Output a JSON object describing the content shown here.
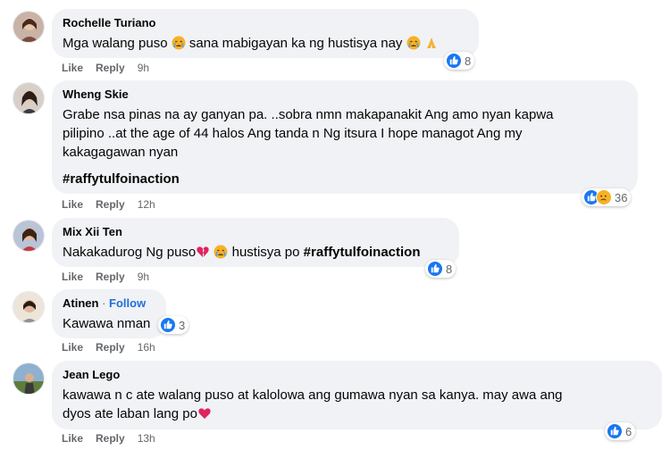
{
  "comments": [
    {
      "author": "Rochelle Turiano",
      "text_a": "Mga walang puso",
      "text_b": "sana mabigayan ka ng hustisya nay",
      "like_label": "Like",
      "reply_label": "Reply",
      "time": "9h",
      "reaction_count": "8"
    },
    {
      "author": "Wheng Skie",
      "lines": [
        "Grabe nsa pinas na ay ganyan pa. ..sobra nmn makapanakit Ang amo nyan kapwa",
        "pilipino ..at the age of 44 halos Ang tanda n Ng itsura I hope managot Ang my",
        "kakagagawan nyan"
      ],
      "hashtag": "#raffytulfoinaction",
      "like_label": "Like",
      "reply_label": "Reply",
      "time": "12h",
      "reaction_count": "36"
    },
    {
      "author": "Mix Xii Ten",
      "text_a": "Nakakadurog Ng puso",
      "text_b": "hustisya po",
      "hashtag": "#raffytulfoinaction",
      "like_label": "Like",
      "reply_label": "Reply",
      "time": "9h",
      "reaction_count": "8"
    },
    {
      "author": "Atinen",
      "separator": "·",
      "follow_label": "Follow",
      "text": "Kawawa nman",
      "like_label": "Like",
      "reply_label": "Reply",
      "time": "16h",
      "reaction_count": "3"
    },
    {
      "author": "Jean Lego",
      "lines": [
        "kawawa n c ate walang puso at kalolowa ang gumawa nyan sa kanya. may awa ang",
        "dyos ate laban lang po"
      ],
      "like_label": "Like",
      "reply_label": "Reply",
      "time": "13h",
      "reaction_count": "6"
    }
  ],
  "colors": {
    "bubble": "#f0f2f5",
    "like_blue": "#1877f2",
    "follow_blue": "#216fdb",
    "meta_gray": "#65676b"
  }
}
